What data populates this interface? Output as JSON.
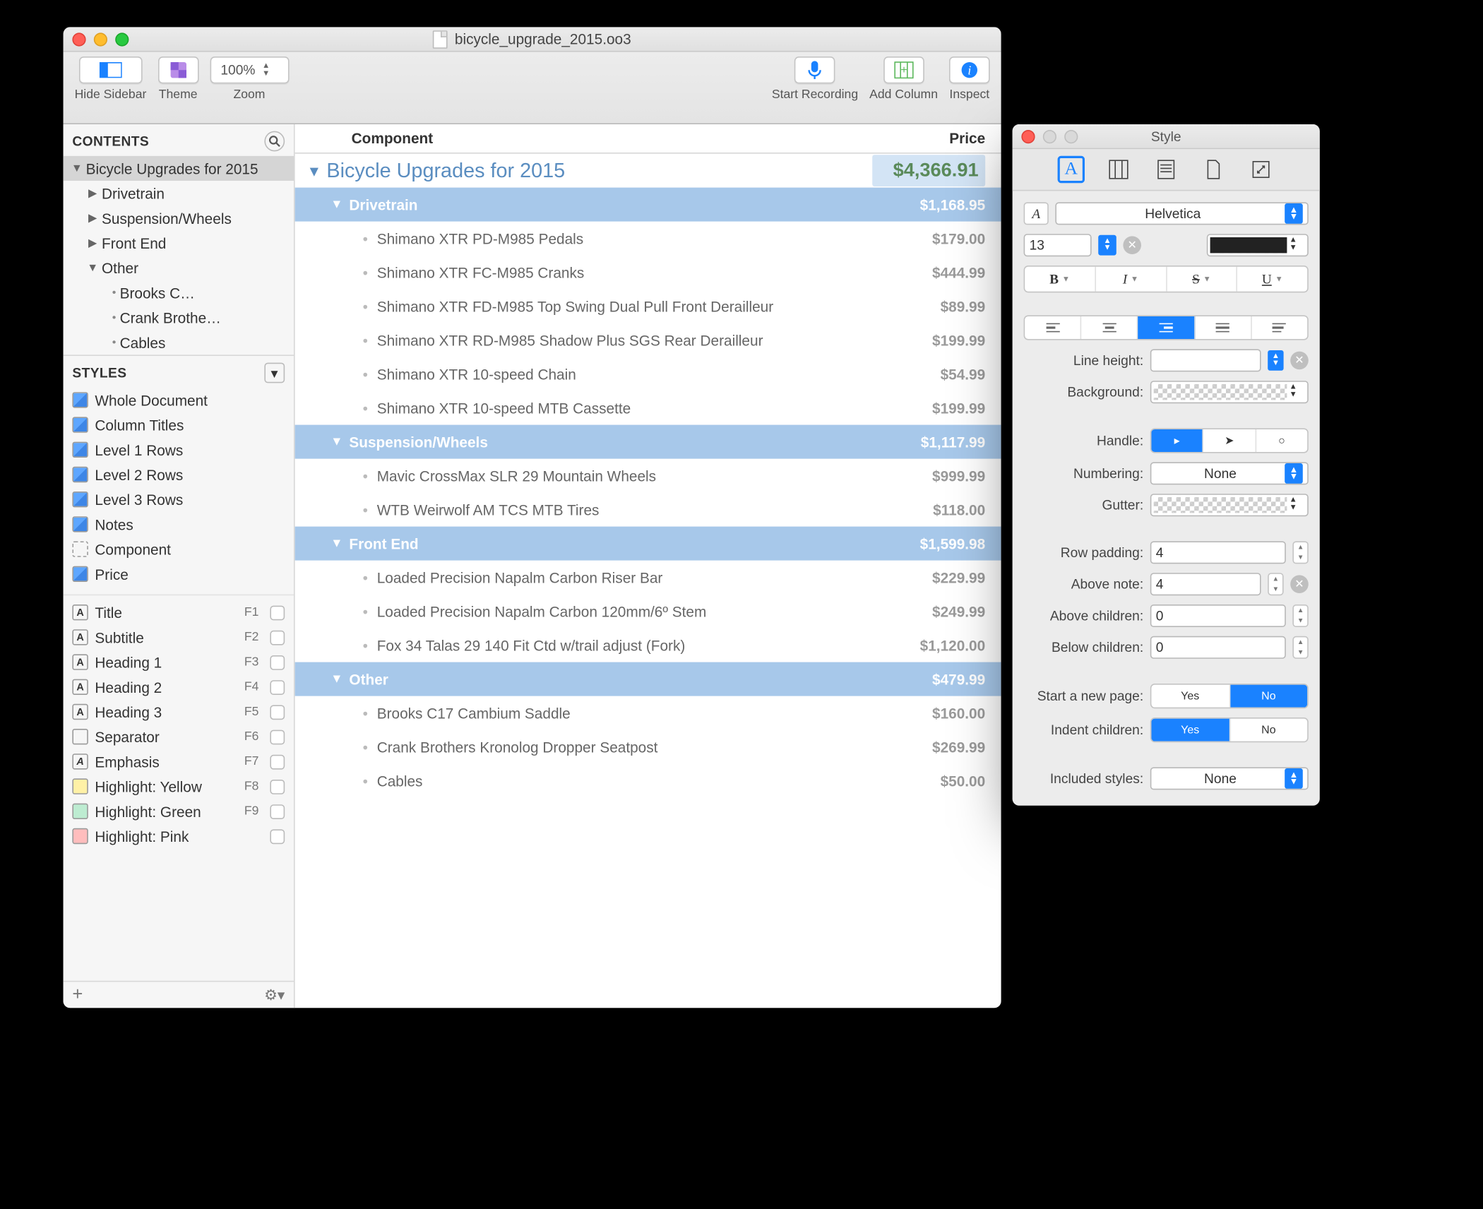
{
  "window": {
    "title": "bicycle_upgrade_2015.oo3"
  },
  "toolbar": {
    "hide_sidebar": "Hide Sidebar",
    "theme": "Theme",
    "zoom": "Zoom",
    "zoom_value": "100%",
    "start_recording": "Start Recording",
    "add_column": "Add Column",
    "inspect": "Inspect"
  },
  "sidebar": {
    "contents_header": "CONTENTS",
    "styles_header": "STYLES",
    "tree": [
      {
        "label": "Bicycle Upgrades for 2015",
        "indent": 0,
        "disc": "down",
        "selected": true
      },
      {
        "label": "Drivetrain",
        "indent": 1,
        "disc": "right"
      },
      {
        "label": "Suspension/Wheels",
        "indent": 1,
        "disc": "right"
      },
      {
        "label": "Front End",
        "indent": 1,
        "disc": "right"
      },
      {
        "label": "Other",
        "indent": 1,
        "disc": "down"
      },
      {
        "label": "Brooks C…",
        "indent": 2,
        "disc": "bullet"
      },
      {
        "label": "Crank Brothe…",
        "indent": 2,
        "disc": "bullet"
      },
      {
        "label": "Cables",
        "indent": 2,
        "disc": "bullet"
      }
    ],
    "styles_top": [
      {
        "label": "Whole Document",
        "icon": "blue"
      },
      {
        "label": "Column Titles",
        "icon": "blue"
      },
      {
        "label": "Level 1 Rows",
        "icon": "blue"
      },
      {
        "label": "Level 2 Rows",
        "icon": "blue"
      },
      {
        "label": "Level 3 Rows",
        "icon": "blue"
      },
      {
        "label": "Notes",
        "icon": "blue"
      },
      {
        "label": "Component",
        "icon": "dashed"
      },
      {
        "label": "Price",
        "icon": "blue"
      }
    ],
    "styles_named": [
      {
        "label": "Title",
        "fkey": "F1",
        "icon": "textA"
      },
      {
        "label": "Subtitle",
        "fkey": "F2",
        "icon": "textA"
      },
      {
        "label": "Heading 1",
        "fkey": "F3",
        "icon": "textA"
      },
      {
        "label": "Heading 2",
        "fkey": "F4",
        "icon": "textA"
      },
      {
        "label": "Heading 3",
        "fkey": "F5",
        "icon": "textA"
      },
      {
        "label": "Separator",
        "fkey": "F6",
        "icon": "plain"
      },
      {
        "label": "Emphasis",
        "fkey": "F7",
        "icon": "textAi"
      },
      {
        "label": "Highlight: Yellow",
        "fkey": "F8",
        "icon": "yellow"
      },
      {
        "label": "Highlight: Green",
        "fkey": "F9",
        "icon": "green"
      },
      {
        "label": "Highlight: Pink",
        "fkey": "",
        "icon": "pink"
      }
    ]
  },
  "columns": {
    "c1": "Component",
    "c2": "Price"
  },
  "rows": [
    {
      "level": 0,
      "name": "Bicycle Upgrades for 2015",
      "price": "$4,366.91"
    },
    {
      "level": 1,
      "name": "Drivetrain",
      "price": "$1,168.95"
    },
    {
      "level": 2,
      "name": "Shimano XTR PD-M985 Pedals",
      "price": "$179.00"
    },
    {
      "level": 2,
      "name": "Shimano XTR FC-M985 Cranks",
      "price": "$444.99"
    },
    {
      "level": 2,
      "name": "Shimano XTR FD-M985 Top Swing Dual Pull Front Derailleur",
      "price": "$89.99"
    },
    {
      "level": 2,
      "name": "Shimano XTR RD-M985 Shadow Plus SGS Rear Derailleur",
      "price": "$199.99"
    },
    {
      "level": 2,
      "name": "Shimano XTR 10-speed Chain",
      "price": "$54.99"
    },
    {
      "level": 2,
      "name": "Shimano XTR 10-speed MTB Cassette",
      "price": "$199.99"
    },
    {
      "level": 1,
      "name": "Suspension/Wheels",
      "price": "$1,117.99"
    },
    {
      "level": 2,
      "name": "Mavic CrossMax SLR 29 Mountain Wheels",
      "price": "$999.99"
    },
    {
      "level": 2,
      "name": "WTB Weirwolf AM TCS MTB Tires",
      "price": "$118.00"
    },
    {
      "level": 1,
      "name": "Front End",
      "price": "$1,599.98"
    },
    {
      "level": 2,
      "name": "Loaded Precision Napalm Carbon Riser Bar",
      "price": "$229.99"
    },
    {
      "level": 2,
      "name": "Loaded Precision Napalm Carbon 120mm/6º Stem",
      "price": "$249.99"
    },
    {
      "level": 2,
      "name": "Fox 34 Talas 29 140 Fit Ctd w/trail adjust (Fork)",
      "price": "$1,120.00"
    },
    {
      "level": 1,
      "name": "Other",
      "price": "$479.99"
    },
    {
      "level": 2,
      "name": "Brooks C17 Cambium Saddle",
      "price": "$160.00"
    },
    {
      "level": 2,
      "name": "Crank Brothers Kronolog Dropper Seatpost",
      "price": "$269.99"
    },
    {
      "level": 2,
      "name": "Cables",
      "price": "$50.00"
    }
  ],
  "inspector": {
    "title": "Style",
    "font_family": "Helvetica",
    "font_size": "13",
    "line_height_label": "Line height:",
    "line_height": "",
    "background_label": "Background:",
    "handle_label": "Handle:",
    "numbering_label": "Numbering:",
    "numbering": "None",
    "gutter_label": "Gutter:",
    "row_padding_label": "Row padding:",
    "row_padding": "4",
    "above_note_label": "Above note:",
    "above_note": "4",
    "above_children_label": "Above children:",
    "above_children": "0",
    "below_children_label": "Below children:",
    "below_children": "0",
    "start_page_label": "Start a new page:",
    "indent_children_label": "Indent children:",
    "included_styles_label": "Included styles:",
    "included_styles": "None",
    "yes": "Yes",
    "no": "No"
  }
}
